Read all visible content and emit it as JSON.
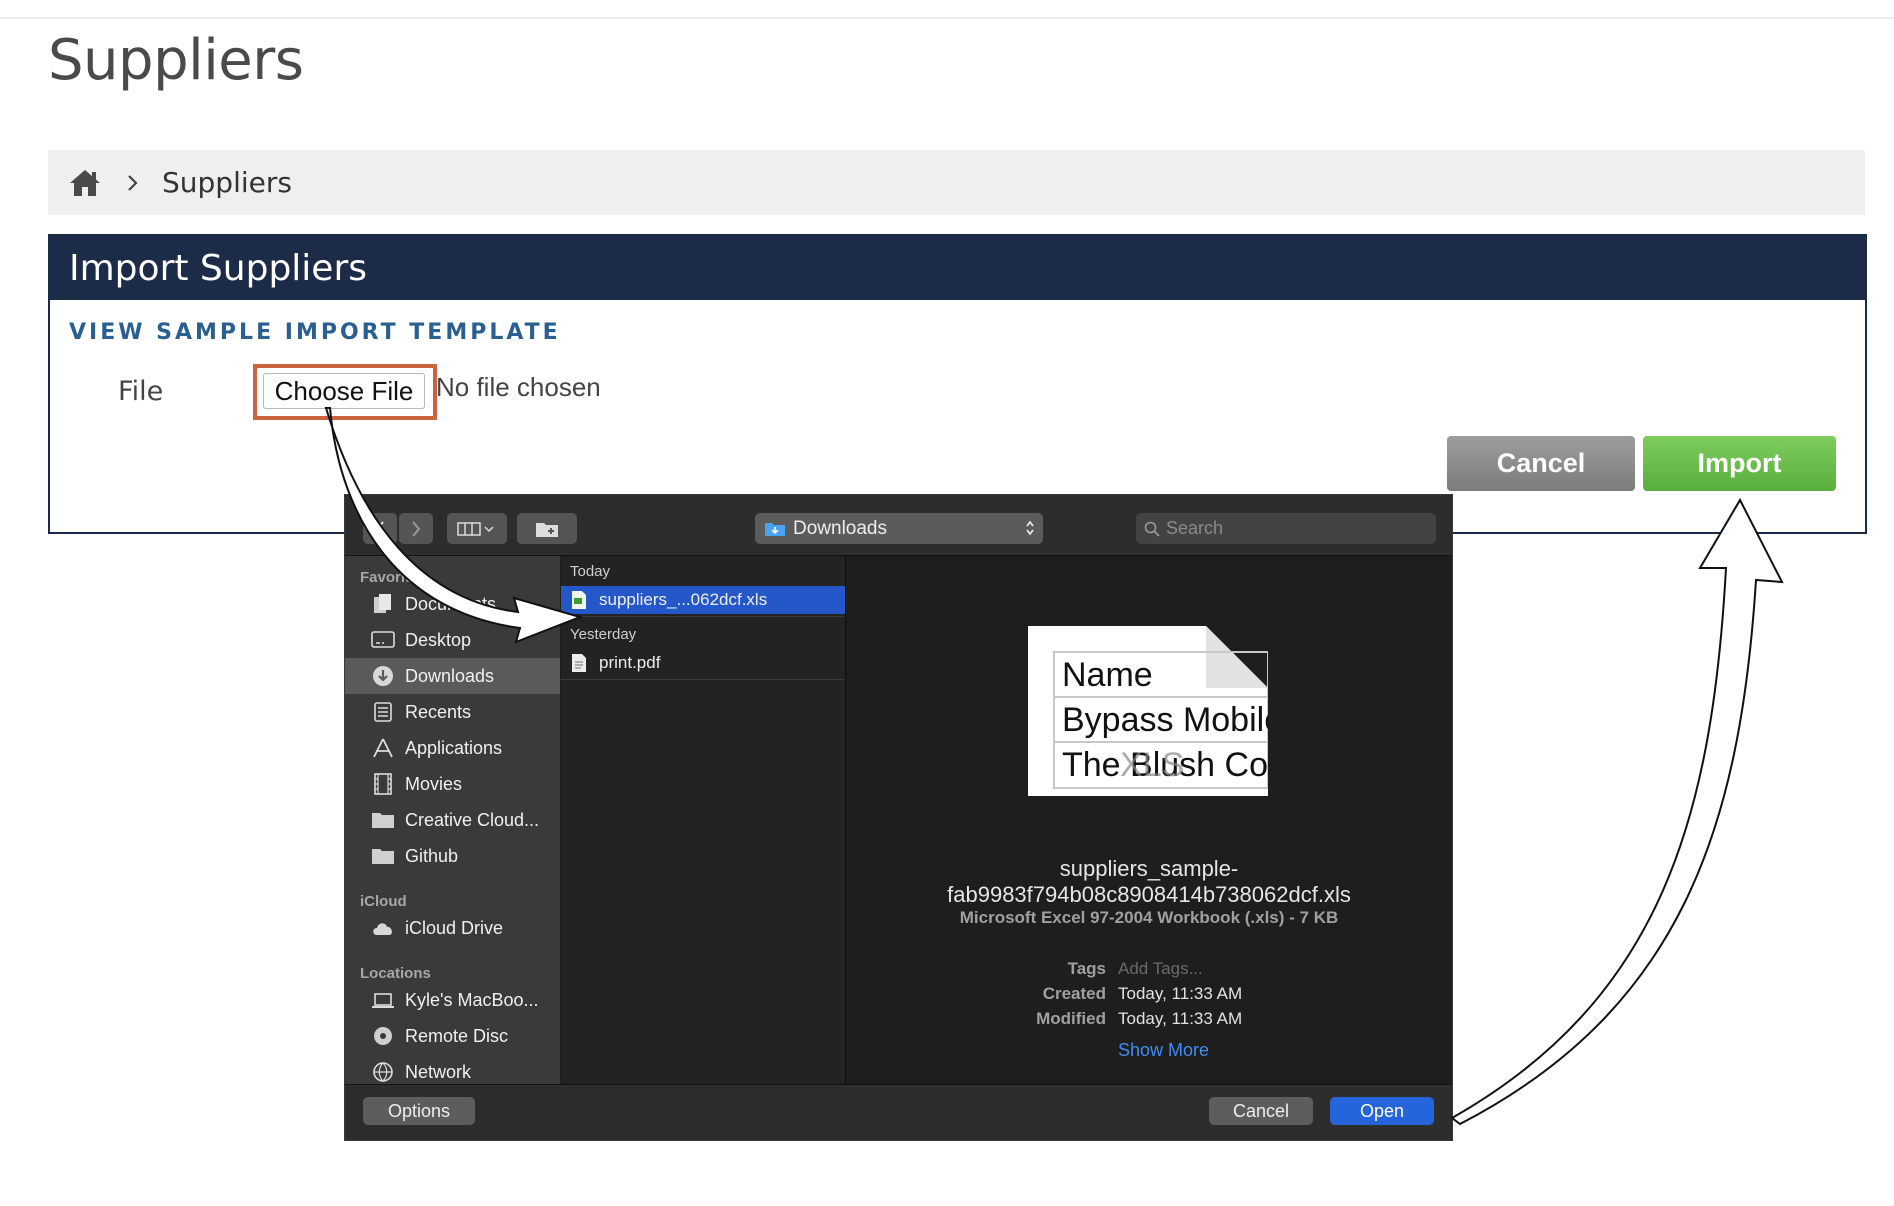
{
  "page": {
    "title": "Suppliers",
    "breadcrumb": {
      "home_icon": "home-icon",
      "current": "Suppliers"
    }
  },
  "panel": {
    "title": "Import Suppliers",
    "sample_link": "VIEW SAMPLE IMPORT TEMPLATE",
    "file_label": "File",
    "choose_file": "Choose File",
    "no_file": "No file chosen",
    "cancel": "Cancel",
    "import": "Import",
    "colors": {
      "header": "#1c2b48",
      "import": "#5fb342",
      "cancel": "#8a8a8a",
      "highlight": "#c9643e"
    }
  },
  "dialog": {
    "location": "Downloads",
    "search_placeholder": "Search",
    "sidebar": {
      "favorites_label": "Favorites",
      "favorites": [
        {
          "label": "Documents",
          "icon": "documents-icon"
        },
        {
          "label": "Desktop",
          "icon": "desktop-icon"
        },
        {
          "label": "Downloads",
          "icon": "downloads-icon",
          "selected": true
        },
        {
          "label": "Recents",
          "icon": "recents-icon"
        },
        {
          "label": "Applications",
          "icon": "applications-icon"
        },
        {
          "label": "Movies",
          "icon": "movies-icon"
        },
        {
          "label": "Creative Cloud...",
          "icon": "folder-icon"
        },
        {
          "label": "Github",
          "icon": "folder-icon"
        }
      ],
      "icloud_label": "iCloud",
      "icloud": [
        {
          "label": "iCloud Drive",
          "icon": "cloud-icon"
        }
      ],
      "locations_label": "Locations",
      "locations": [
        {
          "label": "Kyle's MacBoo...",
          "icon": "laptop-icon"
        },
        {
          "label": "Remote Disc",
          "icon": "disc-icon"
        },
        {
          "label": "Network",
          "icon": "network-icon"
        }
      ]
    },
    "files": {
      "today_label": "Today",
      "today": [
        {
          "name": "suppliers_...062dcf.xls",
          "selected": true
        }
      ],
      "yesterday_label": "Yesterday",
      "yesterday": [
        {
          "name": "print.pdf"
        }
      ]
    },
    "preview": {
      "thumb_rows": [
        "Name",
        "Bypass Mobile",
        "The Blush Com"
      ],
      "thumb_badge": "XLS",
      "file_name_line1": "suppliers_sample-",
      "file_name_line2": "fab9983f794b08c8908414b738062dcf.xls",
      "kind": "Microsoft Excel 97-2004 Workbook (.xls) - 7 KB",
      "tags_label": "Tags",
      "tags_value": "Add Tags...",
      "created_label": "Created",
      "created_value": "Today, 11:33 AM",
      "modified_label": "Modified",
      "modified_value": "Today, 11:33 AM",
      "show_more": "Show More"
    },
    "options": "Options",
    "cancel": "Cancel",
    "open": "Open"
  }
}
